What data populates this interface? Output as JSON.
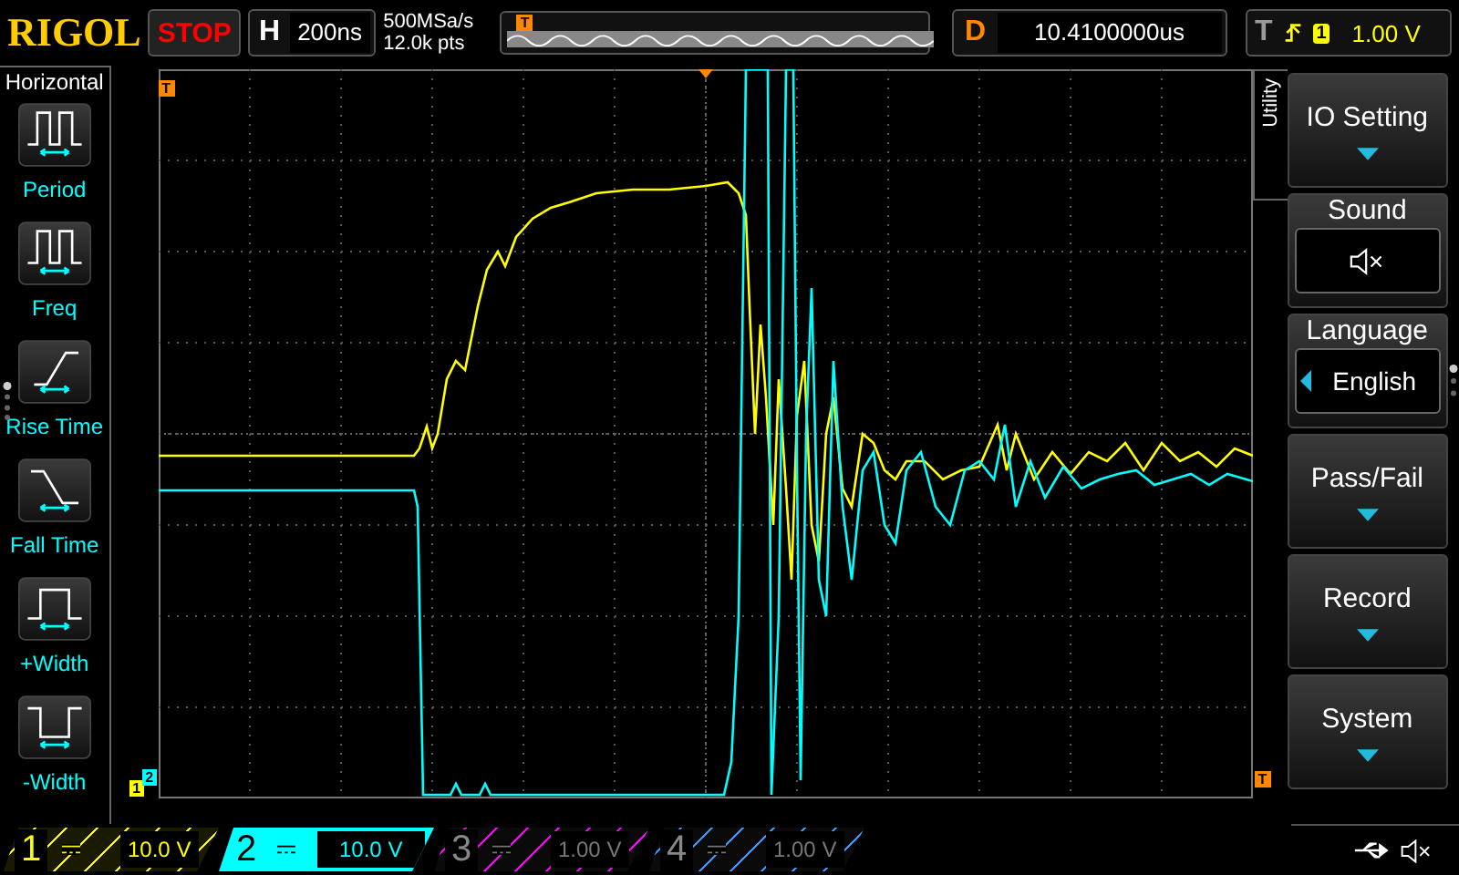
{
  "brand": "RIGOL",
  "run_state": "STOP",
  "horizontal": {
    "label": "H",
    "timebase": "200ns"
  },
  "acquisition": {
    "sample_rate": "500MSa/s",
    "memory_depth": "12.0k pts"
  },
  "overview": {
    "trigger_marker": "T"
  },
  "delay": {
    "label": "D",
    "value": "10.4100000us"
  },
  "trigger": {
    "label": "T",
    "source": "1",
    "level": "1.00 V"
  },
  "left_menu": {
    "title": "Horizontal",
    "items": [
      {
        "kind": "period",
        "label": "Period"
      },
      {
        "kind": "freq",
        "label": "Freq"
      },
      {
        "kind": "rise",
        "label": "Rise Time"
      },
      {
        "kind": "fall",
        "label": "Fall Time"
      },
      {
        "kind": "pwidth",
        "label": "+Width"
      },
      {
        "kind": "nwidth",
        "label": "-Width"
      }
    ]
  },
  "screen": {
    "trigger_position_marker": "T",
    "trigger_level_marker": "T",
    "channel_markers": [
      "1",
      "2"
    ]
  },
  "right_menu": {
    "title": "Utility",
    "items": [
      {
        "kind": "submenu",
        "label": "IO Setting"
      },
      {
        "kind": "toggle",
        "label": "Sound",
        "on": false
      },
      {
        "kind": "select",
        "label": "Language",
        "value": "English"
      },
      {
        "kind": "submenu",
        "label": "Pass/Fail"
      },
      {
        "kind": "submenu",
        "label": "Record"
      },
      {
        "kind": "submenu",
        "label": "System"
      }
    ]
  },
  "channels": [
    {
      "number": "1",
      "scale": "10.0 V",
      "on": true,
      "selected": false,
      "color": "#ffff00"
    },
    {
      "number": "2",
      "scale": "10.0 V",
      "on": true,
      "selected": true,
      "color": "#00ffff"
    },
    {
      "number": "3",
      "scale": "1.00 V",
      "on": false,
      "selected": false,
      "color": "#ff00ff"
    },
    {
      "number": "4",
      "scale": "1.00 V",
      "on": false,
      "selected": false,
      "color": "#3399ff"
    }
  ]
}
